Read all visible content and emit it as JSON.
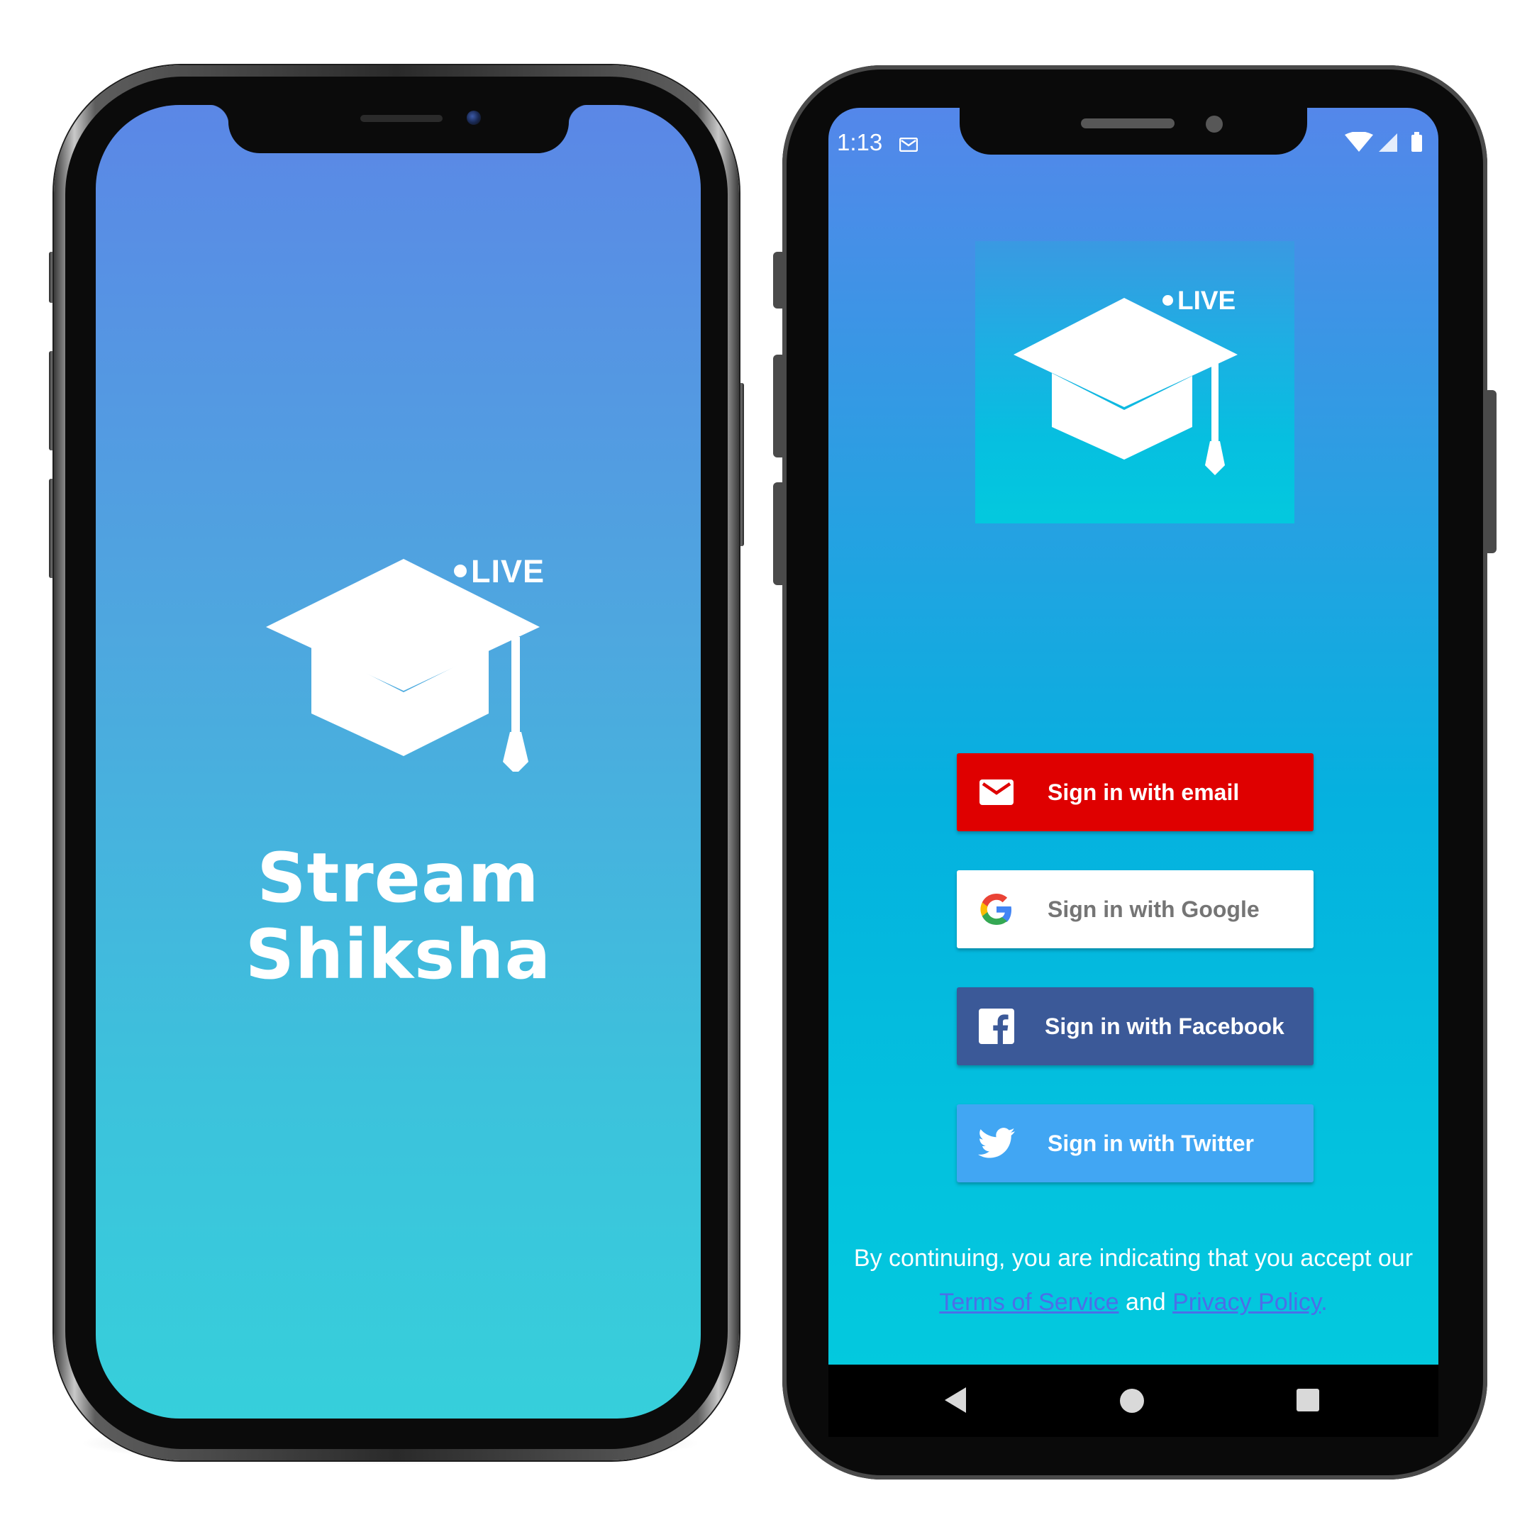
{
  "splash_screen": {
    "live_badge": "LIVE",
    "title_line1": "Stream",
    "title_line2": "Shiksha"
  },
  "signin_screen": {
    "status_bar": {
      "time": "1:13",
      "icons": [
        "mail-icon",
        "wifi-icon",
        "signal-icon",
        "battery-icon"
      ]
    },
    "logo": {
      "live_badge": "LIVE",
      "icon": "graduation-cap-icon"
    },
    "buttons": [
      {
        "label": "Sign in with email",
        "icon": "mail-icon",
        "color": "#df0000"
      },
      {
        "label": "Sign in with Google",
        "icon": "google-icon",
        "color": "#ffffff"
      },
      {
        "label": "Sign in with Facebook",
        "icon": "facebook-icon",
        "color": "#3b5998"
      },
      {
        "label": "Sign in with Twitter",
        "icon": "twitter-icon",
        "color": "#41a6f3"
      }
    ],
    "terms": {
      "prefix": "By continuing, you are indicating that you accept our",
      "tos_link": "Terms of Service",
      "conjunction": " and ",
      "privacy_link": "Privacy Policy",
      "suffix": "."
    },
    "nav_bar": {
      "icons": [
        "back-icon",
        "home-icon",
        "recents-icon"
      ]
    }
  }
}
